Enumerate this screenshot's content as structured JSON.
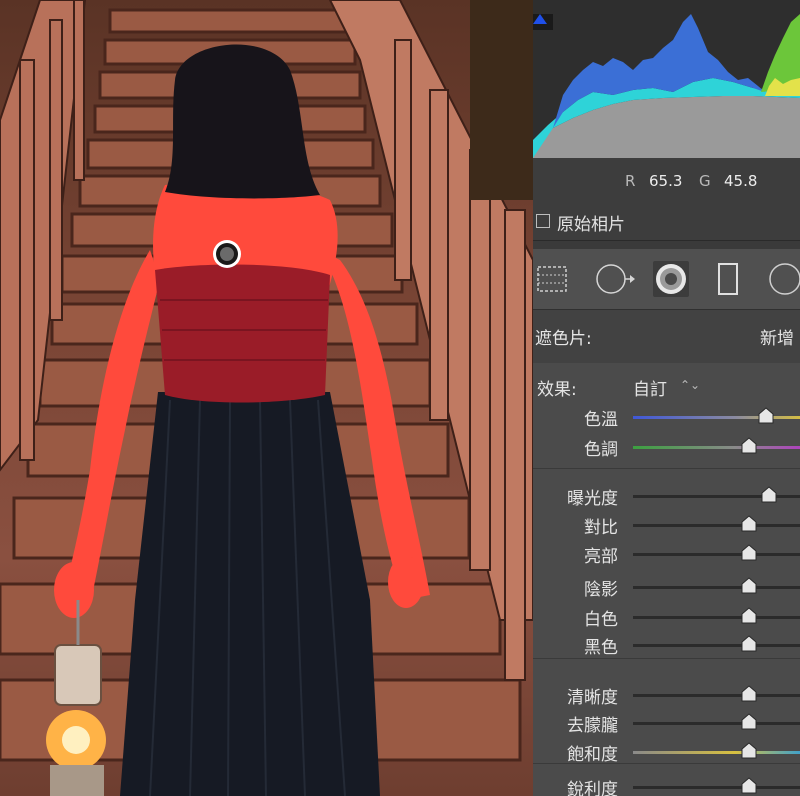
{
  "histogram": {
    "rgb_readout": {
      "r_label": "R",
      "r_value": "65.3",
      "g_label": "G",
      "g_value": "45.8"
    }
  },
  "original_photo": {
    "label": "原始相片",
    "checked": false
  },
  "tools": [
    {
      "name": "graduated-filter",
      "active": false
    },
    {
      "name": "radial-filter",
      "active": false
    },
    {
      "name": "adjustment-brush",
      "active": true
    },
    {
      "name": "crop-frame",
      "active": false
    },
    {
      "name": "spot-tool",
      "active": false
    }
  ],
  "mask": {
    "label": "遮色片:",
    "new_label": "新增"
  },
  "effects": {
    "label": "效果:",
    "preset": "自訂",
    "preset_arrows": "⌃⌄",
    "sliders": [
      {
        "key": "temp",
        "label": "色溫",
        "value": 0.78,
        "style": "temp"
      },
      {
        "key": "tint",
        "label": "色調",
        "value": 0.68,
        "style": "tint"
      },
      {
        "key": "exposure",
        "label": "曝光度",
        "value": 0.8,
        "style": "plain"
      },
      {
        "key": "contrast",
        "label": "對比",
        "value": 0.68,
        "style": "plain"
      },
      {
        "key": "highlights",
        "label": "亮部",
        "value": 0.68,
        "style": "plain"
      },
      {
        "key": "shadows",
        "label": "陰影",
        "value": 0.68,
        "style": "plain"
      },
      {
        "key": "whites",
        "label": "白色",
        "value": 0.68,
        "style": "plain"
      },
      {
        "key": "blacks",
        "label": "黑色",
        "value": 0.68,
        "style": "plain"
      },
      {
        "key": "clarity",
        "label": "清晰度",
        "value": 0.68,
        "style": "plain"
      },
      {
        "key": "dehaze",
        "label": "去朦朧",
        "value": 0.68,
        "style": "plain"
      },
      {
        "key": "saturation",
        "label": "飽和度",
        "value": 0.68,
        "style": "sat"
      },
      {
        "key": "sharpness",
        "label": "銳利度",
        "value": 0.68,
        "style": "plain"
      }
    ]
  },
  "colors": {
    "panel_bg": "#4b4b4b",
    "mask_overlay": "#ff3838",
    "hist_blue": "#3b6fd6",
    "hist_cyan": "#2ed3d8",
    "hist_green": "#6cc63a",
    "hist_yellow": "#e3e24a"
  }
}
